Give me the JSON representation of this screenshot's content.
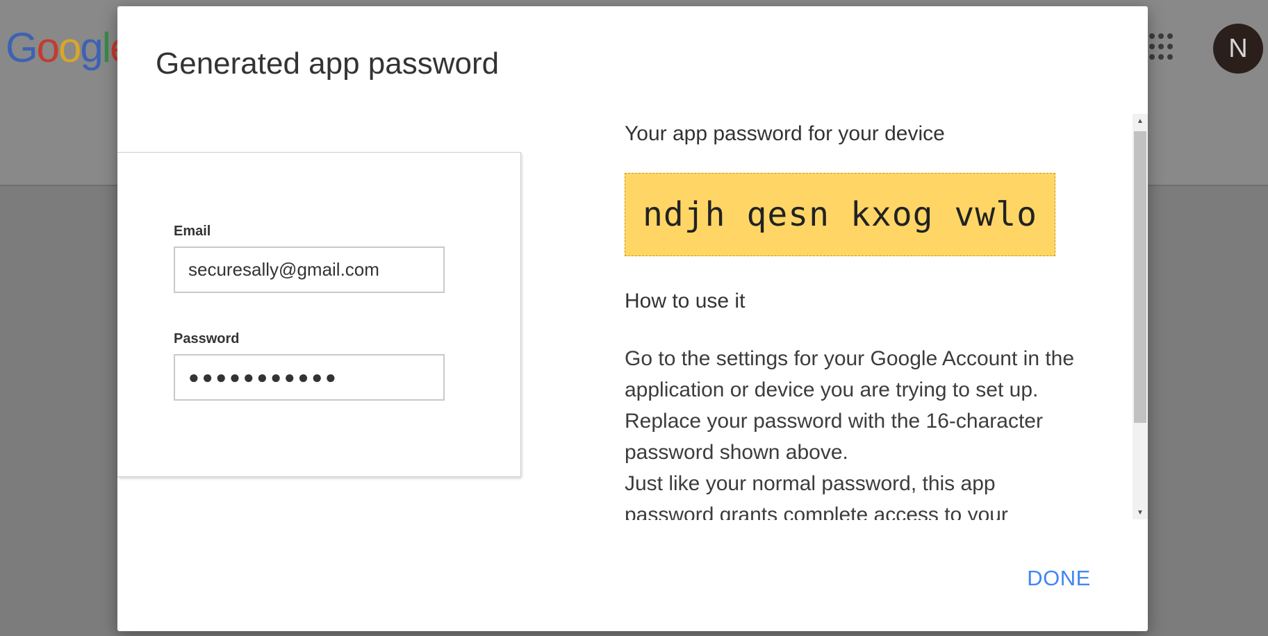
{
  "background": {
    "logo": {
      "letters": [
        {
          "ch": "G",
          "color": "#3d62b4"
        },
        {
          "ch": "o",
          "color": "#c33b2f"
        },
        {
          "ch": "o",
          "color": "#d8a62a"
        },
        {
          "ch": "g",
          "color": "#3d62b4"
        },
        {
          "ch": "l",
          "color": "#3a8a4a"
        },
        {
          "ch": "e",
          "color": "#c33b2f"
        }
      ]
    },
    "apps_icon": "apps-grid-icon",
    "avatar_initial": "N"
  },
  "dialog": {
    "title": "Generated app password",
    "illustration": {
      "email_label": "Email",
      "email_value": "securesally@gmail.com",
      "password_label": "Password",
      "password_dots": "●●●●●●●●●●●"
    },
    "device_heading": "Your app password for your device",
    "app_password": "ndjh qesn kxog vwlo",
    "how_to_heading": "How to use it",
    "instructions": [
      "Go to the settings for your Google Account in the application or device you are trying to set up. Replace your password with the 16-character password shown above.",
      "Just like your normal password, this app password grants complete access to your"
    ],
    "done_label": "DONE",
    "colors": {
      "password_bg": "#ffd666",
      "done_text": "#4285f4"
    }
  }
}
